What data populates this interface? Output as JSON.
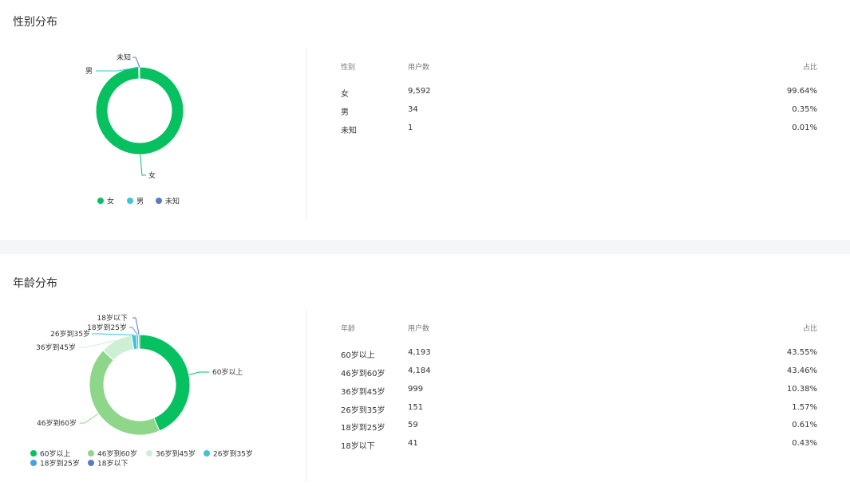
{
  "gender": {
    "title": "性别分布",
    "headers": {
      "category": "性别",
      "users": "用户数",
      "share": "占比"
    },
    "rows": [
      {
        "name": "女",
        "users": "9,592",
        "share": "99.64%"
      },
      {
        "name": "男",
        "users": "34",
        "share": "0.35%"
      },
      {
        "name": "未知",
        "users": "1",
        "share": "0.01%"
      }
    ]
  },
  "age": {
    "title": "年龄分布",
    "headers": {
      "category": "年龄",
      "users": "用户数",
      "share": "占比"
    },
    "rows": [
      {
        "name": "60岁以上",
        "users": "4,193",
        "share": "43.55%"
      },
      {
        "name": "46岁到60岁",
        "users": "4,184",
        "share": "43.46%"
      },
      {
        "name": "36岁到45岁",
        "users": "999",
        "share": "10.38%"
      },
      {
        "name": "26岁到35岁",
        "users": "151",
        "share": "1.57%"
      },
      {
        "name": "18岁到25岁",
        "users": "59",
        "share": "0.61%"
      },
      {
        "name": "18岁以下",
        "users": "41",
        "share": "0.43%"
      }
    ]
  },
  "chart_data": [
    {
      "type": "pie",
      "donut": true,
      "categories": [
        "女",
        "男",
        "未知"
      ],
      "values": [
        9592,
        34,
        1
      ],
      "colors": [
        "#07c160",
        "#3cc5d8",
        "#5b7ac4"
      ],
      "legend_position": "bottom-center"
    },
    {
      "type": "pie",
      "donut": true,
      "categories": [
        "60岁以上",
        "46岁到60岁",
        "36岁到45岁",
        "26岁到35岁",
        "18岁到25岁",
        "18岁以下"
      ],
      "values": [
        4193,
        4184,
        999,
        151,
        59,
        41
      ],
      "colors": [
        "#07c160",
        "#8ed68a",
        "#cdefd4",
        "#3cc5d8",
        "#4a9ee6",
        "#5b7ac4"
      ],
      "legend_position": "bottom-left"
    }
  ]
}
